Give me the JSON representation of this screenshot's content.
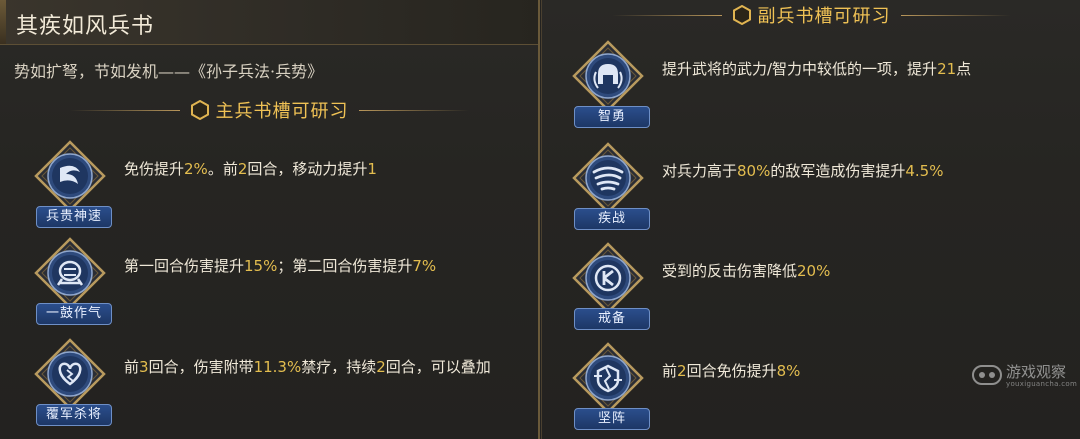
{
  "left_panel": {
    "title": "其疾如风兵书",
    "quote": "势如扩弩，节如发机——《孙子兵法·兵势》",
    "section_title": "主兵书槽可研习",
    "skills": [
      {
        "name": "兵贵神速",
        "icon": "swift-wind-icon",
        "desc_parts": [
          {
            "t": "免伤提升",
            "hl": false
          },
          {
            "t": "2%",
            "hl": true
          },
          {
            "t": "。前",
            "hl": false
          },
          {
            "t": "2",
            "hl": true
          },
          {
            "t": "回合，移动力提升",
            "hl": false
          },
          {
            "t": "1",
            "hl": true
          }
        ]
      },
      {
        "name": "一鼓作气",
        "icon": "war-drum-icon",
        "desc_parts": [
          {
            "t": "第一回合伤害提升",
            "hl": false
          },
          {
            "t": "15%",
            "hl": true
          },
          {
            "t": "；第二回合伤害提升",
            "hl": false
          },
          {
            "t": "7%",
            "hl": true
          }
        ]
      },
      {
        "name": "覆军杀将",
        "icon": "broken-heart-icon",
        "desc_parts": [
          {
            "t": "前",
            "hl": false
          },
          {
            "t": "3",
            "hl": true
          },
          {
            "t": "回合，伤害附带",
            "hl": false
          },
          {
            "t": "11.3%",
            "hl": true
          },
          {
            "t": "禁疗，持续",
            "hl": false
          },
          {
            "t": "2",
            "hl": true
          },
          {
            "t": "回合，可以叠加",
            "hl": false
          }
        ]
      }
    ]
  },
  "right_panel": {
    "section_title": "副兵书槽可研习",
    "skills": [
      {
        "name": "智勇",
        "icon": "helmet-icon",
        "desc_parts": [
          {
            "t": "提升武将的武力/智力中较低的一项，提升",
            "hl": false
          },
          {
            "t": "21",
            "hl": true
          },
          {
            "t": "点",
            "hl": false
          }
        ]
      },
      {
        "name": "疾战",
        "icon": "whirlwind-icon",
        "desc_parts": [
          {
            "t": "对兵力高于",
            "hl": false
          },
          {
            "t": "80%",
            "hl": true
          },
          {
            "t": "的敌军造成伤害提升",
            "hl": false
          },
          {
            "t": "4.5%",
            "hl": true
          }
        ]
      },
      {
        "name": "戒备",
        "icon": "shield-rune-icon",
        "desc_parts": [
          {
            "t": "受到的反击伤害降低",
            "hl": false
          },
          {
            "t": "20%",
            "hl": true
          }
        ]
      },
      {
        "name": "坚阵",
        "icon": "cracked-shield-icon",
        "desc_parts": [
          {
            "t": "前",
            "hl": false
          },
          {
            "t": "2",
            "hl": true
          },
          {
            "t": "回合免伤提升",
            "hl": false
          },
          {
            "t": "8%",
            "hl": true
          }
        ]
      }
    ]
  },
  "watermark": {
    "text": "游戏观察",
    "sub": "youxiguancha.com",
    "icon": "gamepad-icon"
  },
  "colors": {
    "highlight": "#e3bd4f",
    "section_title": "#f0c255",
    "name_tag": "#2b4e8c"
  }
}
